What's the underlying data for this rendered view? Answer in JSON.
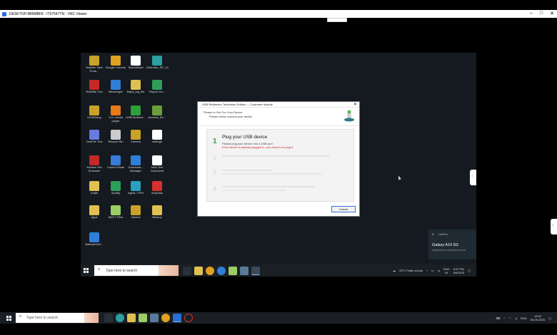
{
  "outer_window": {
    "title": "DESKTOP-9B5MBF8 - IT07547TN - VNC Viewer",
    "controls": [
      "–",
      "□",
      "✕"
    ]
  },
  "desktop_icons": [
    {
      "label": "McAfee Total Prote...",
      "icon": "mcafee-icon",
      "color": "#c9a227"
    },
    {
      "label": "Google Chrome",
      "icon": "chrome-icon",
      "color": "#e0a020"
    },
    {
      "label": "TeamViewer",
      "icon": "teamviewer-icon",
      "color": "#ffffff"
    },
    {
      "label": "Defender_SP_10",
      "icon": "shield-icon",
      "color": "#2ba0a0"
    },
    {
      "label": "RAWMe Tool",
      "icon": "pdf-icon",
      "color": "#c62828"
    },
    {
      "label": "Messenger",
      "icon": "messenger-icon",
      "color": "#2f7fd8"
    },
    {
      "label": "Maps_log_file",
      "icon": "file-icon",
      "color": "#e0c050"
    },
    {
      "label": "Report Vol...",
      "icon": "recycle-icon",
      "color": "#2e9e5a"
    },
    {
      "label": "OCMSetup",
      "icon": "setup-icon",
      "color": "#c9a227"
    },
    {
      "label": "VLC media player",
      "icon": "vlc-icon",
      "color": "#e87a1a"
    },
    {
      "label": "USB Redirect...",
      "icon": "check-icon",
      "color": "#2e9e3a"
    },
    {
      "label": "Android_SK...",
      "icon": "android-icon",
      "color": "#6a9e3a"
    },
    {
      "label": "GeeFire Tool",
      "icon": "usb-icon",
      "color": "#6a7ae0"
    },
    {
      "label": "Recycle Bin",
      "icon": "recycle-bin-icon",
      "color": "#cccccc"
    },
    {
      "label": "Camera",
      "icon": "camera-icon",
      "color": "#c9a227"
    },
    {
      "label": "settings",
      "icon": "document-icon",
      "color": "#ffffff"
    },
    {
      "label": "McAfee File Shredder",
      "icon": "shredder-icon",
      "color": "#c62828"
    },
    {
      "label": "Control Panel",
      "icon": "control-panel-icon",
      "color": "#3a7ad8"
    },
    {
      "label": "Download... Manager",
      "icon": "download-icon",
      "color": "#2f7fd8"
    },
    {
      "label": "New Text Document",
      "icon": "text-doc-icon",
      "color": "#ffffff"
    },
    {
      "label": "mqtts",
      "icon": "folder-icon",
      "color": "#e0c050"
    },
    {
      "label": "Spotify",
      "icon": "spotify-icon",
      "color": "#2e9e5a"
    },
    {
      "label": "Ngrok / VPN",
      "icon": "vpn-icon",
      "color": "#2ba0c0"
    },
    {
      "label": "AnyDesk",
      "icon": "anydesk-icon",
      "color": "#d83030"
    },
    {
      "label": "Apps",
      "icon": "app-icon",
      "color": "#e0c050"
    },
    {
      "label": "MQTT Files",
      "icon": "people-icon",
      "color": "#9ccc65"
    },
    {
      "label": "Volume",
      "icon": "volume-icon",
      "color": "#c9a227"
    },
    {
      "label": "Backup",
      "icon": "backup-icon",
      "color": "#e0c050"
    },
    {
      "label": "BatteryInfoV...",
      "icon": "battery-icon",
      "color": "#2f7fd8"
    }
  ],
  "usb_dialog": {
    "title": "USB Redirector Technician Edition — Customer Module",
    "close_glyph": "✕",
    "intro_line1": "Please to Get Our Your Device",
    "intro_line2": "Please follow connect your device",
    "step_number": "1",
    "step_heading": "Plug your USB device",
    "step_line1": "Please plug your device into a USB port",
    "step_line2": "If the device is already plugged in, you need to re-plug it",
    "cancel_label": "Cancel"
  },
  "notification": {
    "app": "LinkPro",
    "title": "Galaxy A10 5G",
    "body": "Unplaced for connected server"
  },
  "inner_taskbar": {
    "search_placeholder": "Type here to search",
    "weather": "33°C  Partly cloudy",
    "lang_top": "ENG",
    "lang_bottom": "IN",
    "time": "6:57 PM",
    "date": "5/8/2023"
  },
  "outer_taskbar": {
    "search_placeholder": "Type here to search",
    "lang": "ENG",
    "time": "19:02",
    "date": "05-05-2024"
  }
}
